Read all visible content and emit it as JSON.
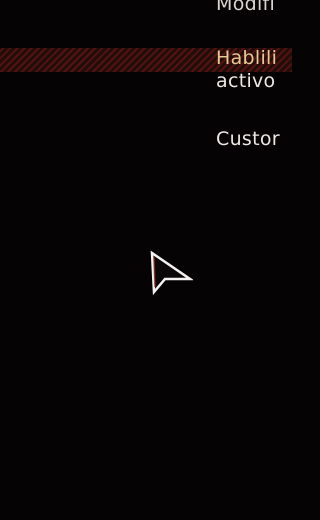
{
  "menu": {
    "items": [
      {
        "label": "Modifi"
      },
      {
        "label": "Hablili",
        "label_continued": "activo"
      },
      {
        "label": "Custor"
      }
    ]
  },
  "colors": {
    "background": "#050304",
    "text": "#ece8e2",
    "highlight_text": "#e7c996",
    "stripe": "#be2a20"
  },
  "cursor": {
    "icon": "pointer-arrow-icon"
  }
}
